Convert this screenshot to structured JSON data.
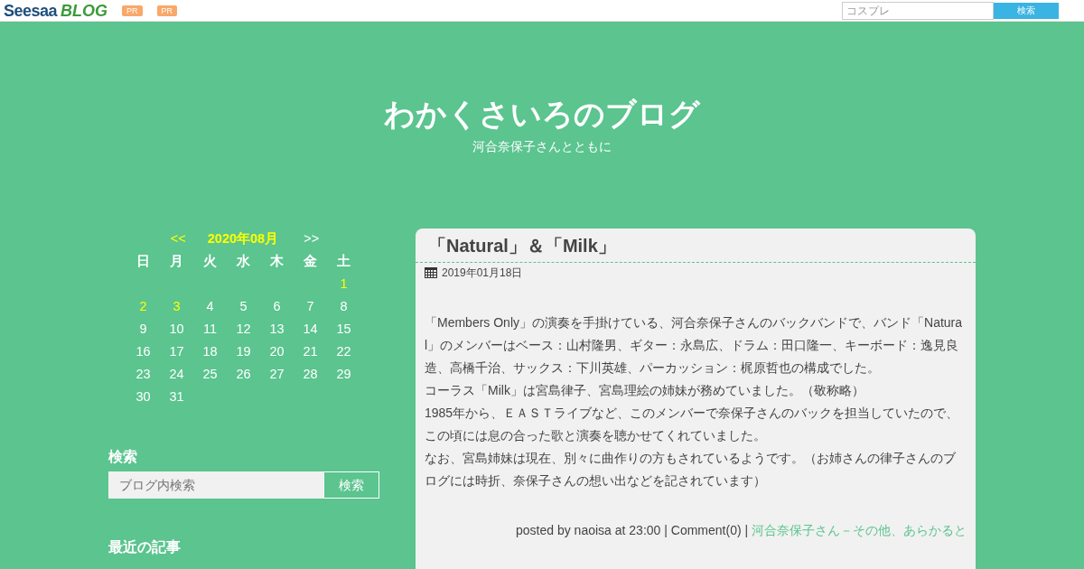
{
  "topbar": {
    "logo_main": "Seesaa",
    "logo_sub": "BLOG",
    "pr_badges": [
      "PR",
      "PR"
    ],
    "search": {
      "placeholder": "コスプレ",
      "button": "検索"
    }
  },
  "header": {
    "title": "わかくさいろのブログ",
    "subtitle": "河合奈保子さんとともに"
  },
  "calendar": {
    "prev": "<<",
    "month": "2020年08月",
    "next": ">>",
    "weekdays": [
      "日",
      "月",
      "火",
      "水",
      "木",
      "金",
      "土"
    ],
    "weeks": [
      {
        "days": [
          {
            "day": "1",
            "linked": true
          }
        ]
      },
      {
        "days": [
          {
            "day": "2",
            "linked": true
          },
          {
            "day": "3",
            "linked": true
          },
          {
            "day": "4",
            "linked": false
          },
          {
            "day": "5",
            "linked": false
          },
          {
            "day": "6",
            "linked": false
          },
          {
            "day": "7",
            "linked": false
          },
          {
            "day": "8",
            "linked": false
          }
        ]
      },
      {
        "days": [
          {
            "day": "9",
            "linked": false
          },
          {
            "day": "10",
            "linked": false
          },
          {
            "day": "11",
            "linked": false
          },
          {
            "day": "12",
            "linked": false
          },
          {
            "day": "13",
            "linked": false
          },
          {
            "day": "14",
            "linked": false
          },
          {
            "day": "15",
            "linked": false
          }
        ]
      },
      {
        "days": [
          {
            "day": "16",
            "linked": false
          },
          {
            "day": "17",
            "linked": false
          },
          {
            "day": "18",
            "linked": false
          },
          {
            "day": "19",
            "linked": false
          },
          {
            "day": "20",
            "linked": false
          },
          {
            "day": "21",
            "linked": false
          },
          {
            "day": "22",
            "linked": false
          }
        ]
      },
      {
        "days": [
          {
            "day": "23",
            "linked": false
          },
          {
            "day": "24",
            "linked": false
          },
          {
            "day": "25",
            "linked": false
          },
          {
            "day": "26",
            "linked": false
          },
          {
            "day": "27",
            "linked": false
          },
          {
            "day": "28",
            "linked": false
          },
          {
            "day": "29",
            "linked": false
          }
        ]
      },
      {
        "days": [
          {
            "day": "30",
            "linked": false
          },
          {
            "day": "31",
            "linked": false
          }
        ]
      }
    ]
  },
  "sidebar_search": {
    "heading": "検索",
    "placeholder": "ブログ内検索",
    "button": "検索"
  },
  "recent_heading": "最近の記事",
  "post": {
    "title": "「Natural」＆「Milk」",
    "date": "2019年01月18日",
    "paragraphs": [
      "「Members Only」の演奏を手掛けている、河合奈保子さんのバックバンドで、バンド「Natural」のメンバーはベース：山村隆男、ギター：永島広、ドラム：田口隆一、キーボード：逸見良造、高橋千治、サックス：下川英雄、パーカッション：梶原哲也の構成でした。",
      "コーラス「Milk」は宮島律子、宮島理絵の姉妹が務めていました。（敬称略）",
      "1985年から、ＥＡＳＴライブなど、このメンバーで奈保子さんのバックを担当していたので、この頃には息の合った歌と演奏を聴かせてくれていました。",
      "なお、宮島姉妹は現在、別々に曲作りの方もされているようです。（お姉さんの律子さんのブログには時折、奈保子さんの想い出などを記されています）"
    ],
    "footer": {
      "posted": "posted by naoisa at 23:00",
      "sep1": "|",
      "comment": "Comment(0)",
      "sep2": "|",
      "category": "河合奈保子さん－その他、あらかると"
    }
  }
}
